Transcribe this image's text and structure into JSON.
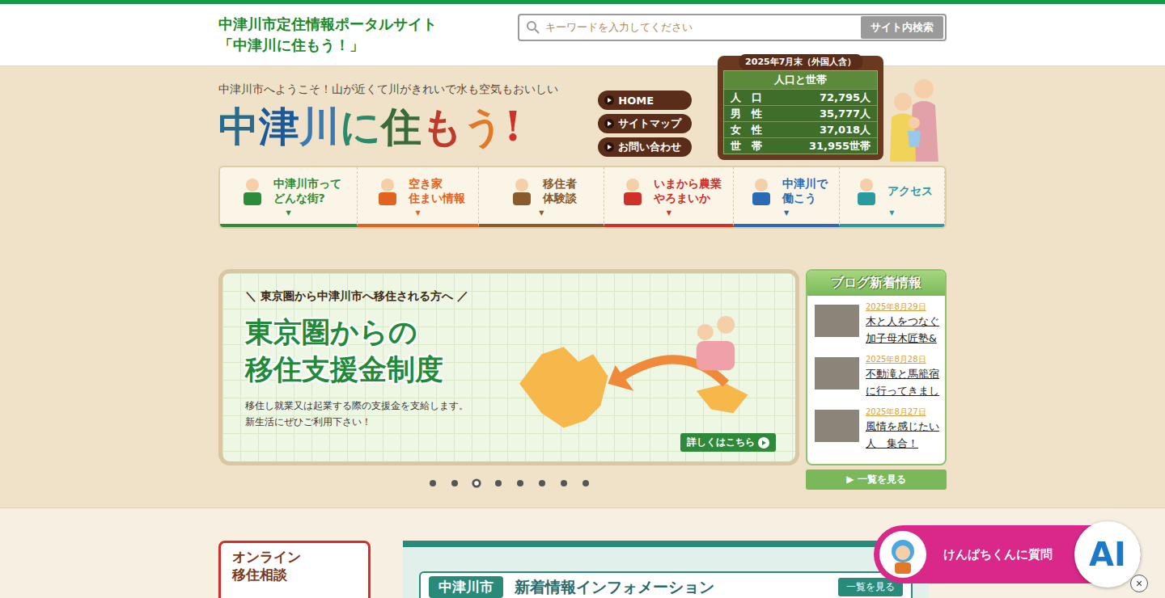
{
  "header": {
    "title_lines": [
      "中津川市定住情報ポータルサイト",
      "「中津川に住もう！」"
    ],
    "search": {
      "placeholder": "キーワードを入力してください",
      "button": "サイト内検索"
    }
  },
  "hero": {
    "tagline": "中津川市へようこそ！山が近くて川がきれいで水も空気もおいしい",
    "logo": "中津川に住もう!",
    "quick_links": [
      "HOME",
      "サイトマップ",
      "お問い合わせ"
    ],
    "population": {
      "date": "2025年7月末（外国人含）",
      "title": "人口と世帯",
      "rows": [
        {
          "label": "人　口",
          "value": "72,795人"
        },
        {
          "label": "男　性",
          "value": "35,777人"
        },
        {
          "label": "女　性",
          "value": "37,018人"
        },
        {
          "label": "世　帯",
          "value": "31,955世帯"
        }
      ]
    }
  },
  "menu": [
    {
      "lines": [
        "中津川市って",
        "どんな街?"
      ],
      "color": "#2e8b3a"
    },
    {
      "lines": [
        "空き家",
        "住まい情報"
      ],
      "color": "#e0641e"
    },
    {
      "lines": [
        "移住者",
        "体験談"
      ],
      "color": "#8a5a2b"
    },
    {
      "lines": [
        "いまから農業",
        "やろまいか"
      ],
      "color": "#d0302a"
    },
    {
      "lines": [
        "中津川で",
        "働こう"
      ],
      "color": "#2a6ab5"
    },
    {
      "lines": [
        "アクセス"
      ],
      "color": "#2a9aa0"
    }
  ],
  "menu_arrow": "▼",
  "slide": {
    "kicker": "＼ 東京圏から中津川市へ移住される方へ ／",
    "title_lines": [
      "東京圏からの",
      "移住支援金制度"
    ],
    "desc_lines": [
      "移住し就業又は起業する際の支援金を支給します。",
      "新生活にぜひご利用下さい！"
    ],
    "button": "詳しくはこちら"
  },
  "dots": [
    {
      "selected": false
    },
    {
      "selected": false
    },
    {
      "selected": true
    },
    {
      "selected": false
    },
    {
      "selected": false
    },
    {
      "selected": false
    },
    {
      "selected": false
    },
    {
      "selected": false
    }
  ],
  "blog": {
    "title": "ブログ新着情報",
    "items": [
      {
        "date": "2025年8月29日",
        "title": "木と人をつなぐ加子母木匠塾&"
      },
      {
        "date": "2025年8月28日",
        "title": "不動滝と馬籠宿に行ってきまし"
      },
      {
        "date": "2025年8月27日",
        "title": "風情を感じたい人　集合！"
      }
    ],
    "more": "▶ 一覧を見る"
  },
  "online": {
    "lines": [
      "オンライン",
      "移住相談"
    ]
  },
  "info": {
    "city": "中津川市",
    "title": "新着情報インフォメーション",
    "more": "一覧を見る"
  },
  "ai": {
    "label": "けんぱちくんに質問",
    "badge": "AI",
    "close": "×"
  }
}
